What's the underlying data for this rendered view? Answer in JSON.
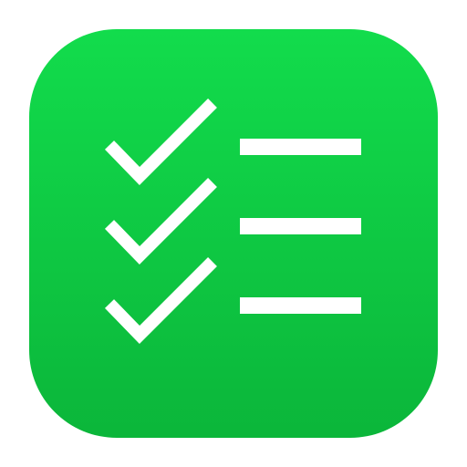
{
  "icon": {
    "name": "checklist-app-icon",
    "background_top": "#12DC4C",
    "background_bottom": "#0BB63A",
    "glyph_color": "#FFFFFF",
    "rows": [
      {
        "check": "checkmark-icon",
        "line": "list-line"
      },
      {
        "check": "checkmark-icon",
        "line": "list-line"
      },
      {
        "check": "checkmark-icon",
        "line": "list-line"
      }
    ]
  }
}
